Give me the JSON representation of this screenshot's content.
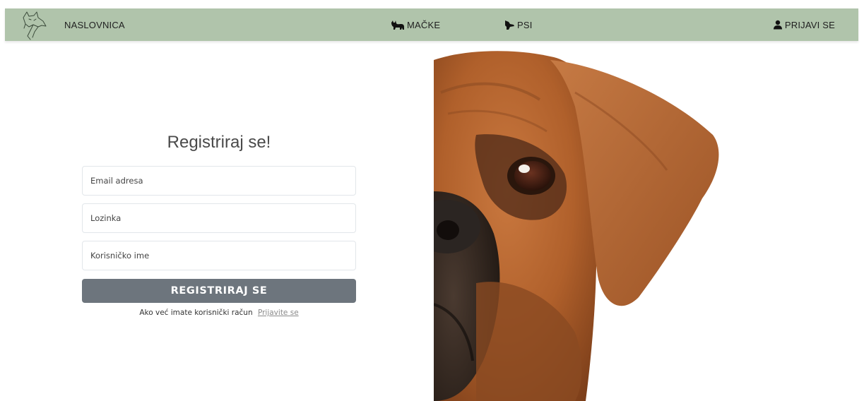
{
  "nav": {
    "home_label": "NASLOVNICA",
    "cats_label": "MAČKE",
    "dogs_label": "PSI",
    "login_label": "PRIJAVI SE",
    "icons": {
      "logo": "cat-dog-logo-icon",
      "cats": "cat-icon",
      "dogs": "dog-icon",
      "login": "user-icon"
    },
    "bg_color": "#b0c4ab"
  },
  "form": {
    "title": "Registriraj se!",
    "email_placeholder": "Email adresa",
    "password_placeholder": "Lozinka",
    "username_placeholder": "Korisničko ime",
    "submit_label": "REGISTRIRAJ SE",
    "login_prompt": "Ako već imate korisnički račun",
    "login_link": "Prijavite se",
    "button_color": "#6d757d"
  },
  "image": {
    "subject": "boxer-dog-face-photo"
  }
}
